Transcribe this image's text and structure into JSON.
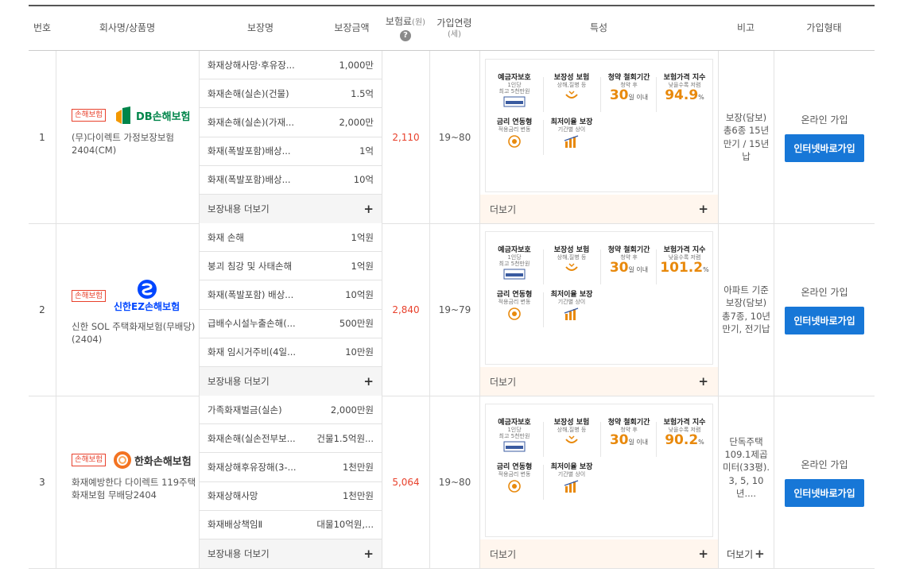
{
  "headers": {
    "no": "번호",
    "company": "회사명/상품명",
    "coverage": "보장명",
    "amount": "보장금액",
    "premium": "보험료",
    "premium_unit": "(원)",
    "age": "가입연령",
    "age_unit": "(세)",
    "feature": "특성",
    "note": "비고",
    "join": "가입형태"
  },
  "rows": [
    {
      "no": "1",
      "tag": "손해보험",
      "logo": "DB손해보험",
      "product": "(무)다이렉트 가정보장보험 2404(CM)",
      "premium": "2,110",
      "age": "19~80",
      "coverages": [
        {
          "name": "화재상해사망·후유장...",
          "amount": "1,000만"
        },
        {
          "name": "화재손해(실손)(건물)",
          "amount": "1.5억"
        },
        {
          "name": "화재손해(실손)(가재...",
          "amount": "2,000만"
        },
        {
          "name": "화재(폭발포함)배상...",
          "amount": "1억"
        },
        {
          "name": "화재(폭발포함)배상...",
          "amount": "10억"
        }
      ],
      "more": "보장내용 더보기",
      "feature_value": "94.9",
      "note": "보장(담보) 총6종 15년만기 / 15년납",
      "join_type": "온라인 가입",
      "join_btn": "인터넷바로가입"
    },
    {
      "no": "2",
      "tag": "손해보험",
      "logo": "신한EZ손해보험",
      "product": "신한 SOL 주택화재보험(무배당)(2404)",
      "premium": "2,840",
      "age": "19~79",
      "coverages": [
        {
          "name": "화재 손해",
          "amount": "1억원"
        },
        {
          "name": "붕괴 침강 및 사태손해",
          "amount": "1억원"
        },
        {
          "name": "화재(폭발포함) 배상...",
          "amount": "10억원"
        },
        {
          "name": "급배수시설누출손해(...",
          "amount": "500만원"
        },
        {
          "name": "화재 임시거주비(4일...",
          "amount": "10만원"
        }
      ],
      "more": "보장내용 더보기",
      "feature_value": "101.2",
      "note": "아파트 기준 보장(담보) 총7종, 10년만기, 전기납",
      "join_type": "온라인 가입",
      "join_btn": "인터넷바로가입"
    },
    {
      "no": "3",
      "tag": "손해보험",
      "logo": "한화손해보험",
      "product": "화재예방한다 다이렉트 119주택화재보험 무배당2404",
      "premium": "5,064",
      "age": "19~80",
      "coverages": [
        {
          "name": "가족화재벌금(실손)",
          "amount": "2,000만원"
        },
        {
          "name": "화재손해(실손전부보...",
          "amount": "건물1.5억원..."
        },
        {
          "name": "화재상해후유장해(3-...",
          "amount": "1천만원"
        },
        {
          "name": "화재상해사망",
          "amount": "1천만원"
        },
        {
          "name": "화재배상책임Ⅱ",
          "amount": "대물10억원,..."
        }
      ],
      "more": "보장내용 더보기",
      "feature_value": "90.2",
      "note": "단독주택 109.1제곱미터(33평). 3, 5, 10년....",
      "note_more": "더보기",
      "join_type": "온라인 가입",
      "join_btn": "인터넷바로가입"
    }
  ],
  "feature": {
    "deposit_title": "예금자보호",
    "deposit_sub1": "1인당",
    "deposit_sub2": "최고 5천만원",
    "guar_title": "보장성 보험",
    "guar_sub": "상해,질병 등",
    "cancel_title": "청약 철회기간",
    "cancel_sub": "청약 후",
    "cancel_val": "30",
    "cancel_unit": "일 이내",
    "price_title": "보험가격 지수",
    "price_sub": "낮을수록 저렴",
    "price_unit": "%",
    "rate_title": "금리 연동형",
    "rate_sub": "적용금리 변동",
    "min_title": "최저이율 보장",
    "min_sub": "기간별 상이",
    "more": "더보기"
  },
  "colors": {
    "accent": "#e8412c",
    "button": "#1777d7",
    "orange": "#e8890c"
  }
}
